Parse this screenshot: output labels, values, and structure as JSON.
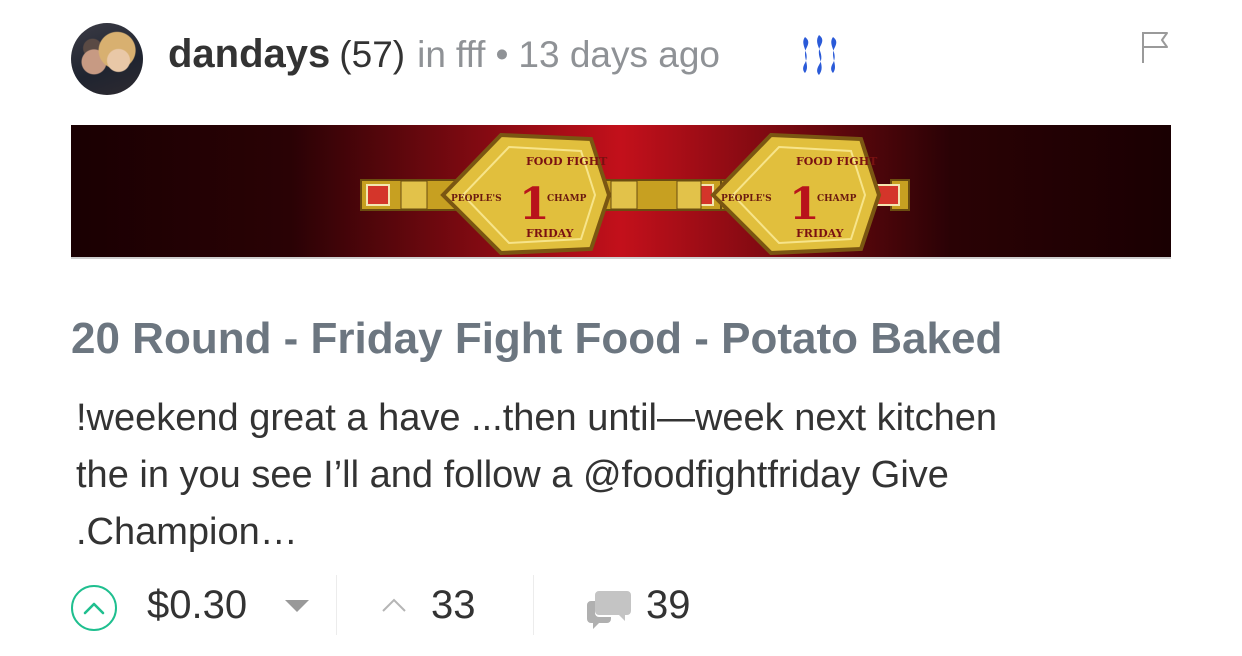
{
  "post": {
    "author": "dandays",
    "reputation": "(57)",
    "in_label": "in",
    "community": "fff",
    "separator": "•",
    "time_ago": "13 days ago",
    "banner": {
      "belt_top_text": "FOOD FIGHT",
      "belt_left_text": "PEOPLE'S",
      "belt_right_text": "CHAMP",
      "belt_bottom_text": "FRIDAY",
      "belt_number": "1"
    },
    "title": "20 Round - Friday Fight Food - Potato Baked",
    "excerpt_lines": [
      "!weekend great a have ...then until—week next kitchen",
      "the in you see I’ll and follow a @foodfightfriday Give",
      ".Champion…"
    ]
  },
  "footer": {
    "payout": "$0.30",
    "votes": "33",
    "comments": "39"
  },
  "colors": {
    "accent_green": "#1fbf8f",
    "steem_blue": "#2a5ad8",
    "title_gray": "#6c7680",
    "meta_gray": "#8f9296",
    "text_dark": "#333333"
  },
  "icons": [
    "avatar",
    "steem-logo-icon",
    "flag-icon",
    "upvote-icon",
    "caret-down-icon",
    "votes-up-icon",
    "comment-icon"
  ]
}
